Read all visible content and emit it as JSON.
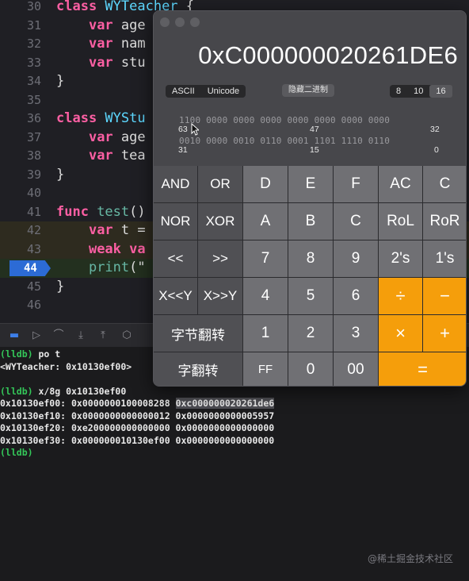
{
  "editor": {
    "lines": [
      {
        "n": "30",
        "parts": [
          [
            "kw",
            "class "
          ],
          [
            "ty",
            "WYTeacher "
          ],
          [
            "id",
            "{"
          ]
        ]
      },
      {
        "n": "31",
        "parts": [
          [
            "id",
            "    "
          ],
          [
            "kw",
            "var "
          ],
          [
            "id",
            "age"
          ]
        ]
      },
      {
        "n": "32",
        "parts": [
          [
            "id",
            "    "
          ],
          [
            "kw",
            "var "
          ],
          [
            "id",
            "nam"
          ]
        ]
      },
      {
        "n": "33",
        "parts": [
          [
            "id",
            "    "
          ],
          [
            "kw",
            "var "
          ],
          [
            "id",
            "stu"
          ]
        ]
      },
      {
        "n": "34",
        "parts": [
          [
            "id",
            "}"
          ]
        ]
      },
      {
        "n": "35",
        "parts": []
      },
      {
        "n": "36",
        "parts": [
          [
            "kw",
            "class "
          ],
          [
            "ty",
            "WYStu"
          ]
        ]
      },
      {
        "n": "37",
        "parts": [
          [
            "id",
            "    "
          ],
          [
            "kw",
            "var "
          ],
          [
            "id",
            "age"
          ]
        ]
      },
      {
        "n": "38",
        "parts": [
          [
            "id",
            "    "
          ],
          [
            "kw",
            "var "
          ],
          [
            "id",
            "tea"
          ]
        ]
      },
      {
        "n": "39",
        "parts": [
          [
            "id",
            "}"
          ]
        ]
      },
      {
        "n": "40",
        "parts": []
      },
      {
        "n": "41",
        "parts": [
          [
            "kw",
            "func "
          ],
          [
            "fn",
            "test"
          ],
          [
            "id",
            "()"
          ]
        ]
      },
      {
        "n": "42",
        "parts": [
          [
            "id",
            "    "
          ],
          [
            "kw",
            "var "
          ],
          [
            "id",
            "t ="
          ]
        ]
      },
      {
        "n": "43",
        "parts": [
          [
            "id",
            "    "
          ],
          [
            "kw",
            "weak "
          ],
          [
            "kw",
            "va"
          ]
        ]
      },
      {
        "n": "44",
        "parts": [
          [
            "id",
            "    "
          ],
          [
            "fn",
            "print"
          ],
          [
            "id",
            "(\""
          ]
        ]
      },
      {
        "n": "45",
        "parts": [
          [
            "id",
            "}"
          ]
        ]
      },
      {
        "n": "46",
        "parts": []
      }
    ]
  },
  "console": {
    "lines": [
      {
        "prompt": "(lldb)",
        "text": " po t"
      },
      {
        "prompt": "",
        "text": "<WYTeacher: 0x10130ef00>"
      },
      {
        "prompt": "",
        "text": ""
      },
      {
        "prompt": "(lldb)",
        "text": " x/8g 0x10130ef00"
      },
      {
        "prompt": "",
        "text": "0x10130ef00: 0x0000000100008288 ",
        "sel": "0xc000000020261de6"
      },
      {
        "prompt": "",
        "text": "0x10130ef10: 0x0000000000000012 0x0000000000005957"
      },
      {
        "prompt": "",
        "text": "0x10130ef20: 0xe200000000000000 0x0000000000000000"
      },
      {
        "prompt": "",
        "text": "0x10130ef30: 0x000000010130ef00 0x0000000000000000"
      },
      {
        "prompt": "(lldb)",
        "text": ""
      }
    ],
    "watermark": "@稀土掘金技术社区"
  },
  "calculator": {
    "display": "0xC000000020261DE6",
    "encoding": {
      "options": [
        "ASCII",
        "Unicode"
      ]
    },
    "hide_binary_label": "隐藏二进制",
    "base": {
      "options": [
        "8",
        "10",
        "16"
      ],
      "selected": "16"
    },
    "bits_row1": "1100 0000 0000 0000 0000 0000 0000 0000",
    "bits_row2": "0010 0000 0010 0110 0001 1101 1110 0110",
    "bit_labels": {
      "r1_left": "63",
      "r1_mid": "47",
      "r1_right": "32",
      "r2_left": "31",
      "r2_mid": "15",
      "r2_right": "0"
    },
    "keys": {
      "and": "AND",
      "or": "OR",
      "d": "D",
      "e": "E",
      "f": "F",
      "ac": "AC",
      "c": "C",
      "nor": "NOR",
      "xor": "XOR",
      "a": "A",
      "b": "B",
      "c_hex": "C",
      "rol": "RoL",
      "ror": "RoR",
      "shl": "<<",
      "shr": ">>",
      "seven": "7",
      "eight": "8",
      "nine": "9",
      "twos": "2's",
      "ones": "1's",
      "xshly": "X<<Y",
      "xshry": "X>>Y",
      "four": "4",
      "five": "5",
      "six": "6",
      "divide": "÷",
      "minus": "−",
      "byteflip": "字节翻转",
      "one": "1",
      "two": "2",
      "three": "3",
      "multiply": "×",
      "plus": "+",
      "wordflip": "字翻转",
      "ff": "FF",
      "zero": "0",
      "dzero": "00",
      "equals": "="
    }
  }
}
